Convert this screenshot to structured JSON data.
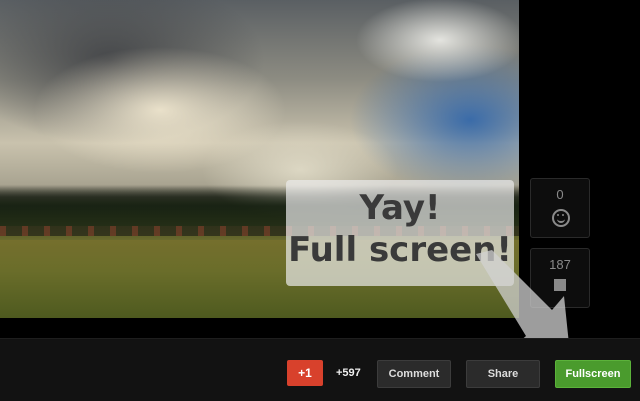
{
  "tooltip": {
    "line1": "Yay!",
    "line2": "Full screen!"
  },
  "side_panel": {
    "first_box": {
      "value": "0",
      "icon": "smiley-icon"
    },
    "second_box": {
      "value": "187",
      "icon": "square-icon"
    }
  },
  "toolbar": {
    "plus_one_label": "+1",
    "plus_one_count": "+597",
    "comment_label": "Comment",
    "share_label": "Share",
    "fullscreen_label": "Fullscreen"
  },
  "colors": {
    "plus_one": "#d8412c",
    "fullscreen": "#4a9b2d",
    "bar": "#121212"
  }
}
